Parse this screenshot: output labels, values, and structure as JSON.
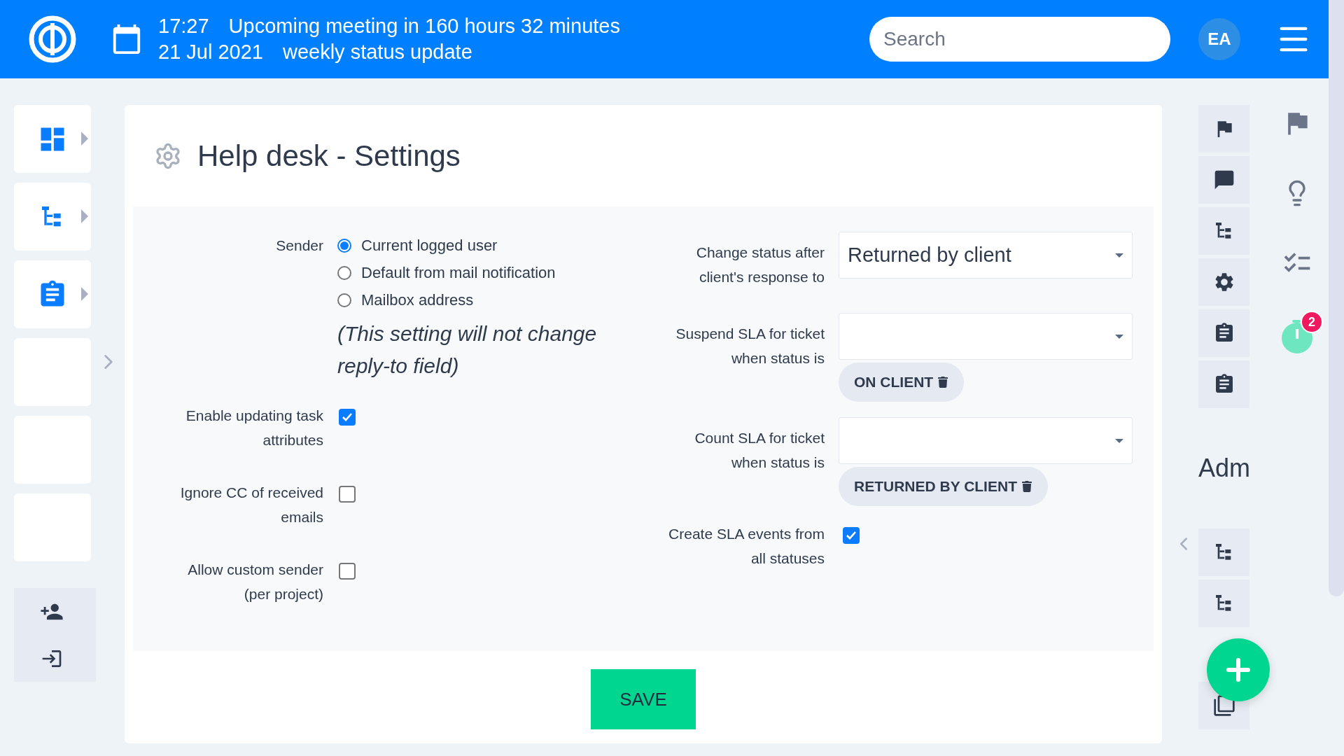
{
  "topbar": {
    "time": "17:27",
    "date": "21 Jul 2021",
    "meeting": "Upcoming meeting in 160 hours 32 minutes",
    "meeting_title": "weekly status update",
    "search": {
      "placeholder": "Search"
    },
    "avatar": "EA"
  },
  "page": {
    "title": "Help desk - Settings"
  },
  "left_fields": [
    {
      "kind": "radio",
      "label": "Sender",
      "options": [
        {
          "label": "Current logged user",
          "selected": true
        },
        {
          "label": "Default from mail notification",
          "selected": false
        },
        {
          "label": "Mailbox address",
          "selected": false
        }
      ],
      "note": "(This setting will not change reply-to field)"
    },
    {
      "kind": "checkbox",
      "label": "Enable updating task attributes",
      "checked": true
    },
    {
      "kind": "checkbox",
      "label": "Ignore CC of received emails",
      "checked": false
    },
    {
      "kind": "checkbox",
      "label": "Allow custom sender (per project)",
      "checked": false
    }
  ],
  "right_fields": [
    {
      "kind": "select",
      "label": "Change status after client's response to",
      "value": "Returned by client"
    },
    {
      "kind": "select",
      "label": "Suspend SLA for ticket when status is",
      "tags": [
        "ON CLIENT"
      ]
    },
    {
      "kind": "select",
      "label": "Count SLA for ticket when status is",
      "tags": [
        "RETURNED BY CLIENT"
      ]
    },
    {
      "kind": "checkbox",
      "label": "Create SLA events from all statuses",
      "checked": true
    }
  ],
  "save": "SAVE",
  "right_panel": {
    "heading": "Adm",
    "timer_badge": "2"
  }
}
